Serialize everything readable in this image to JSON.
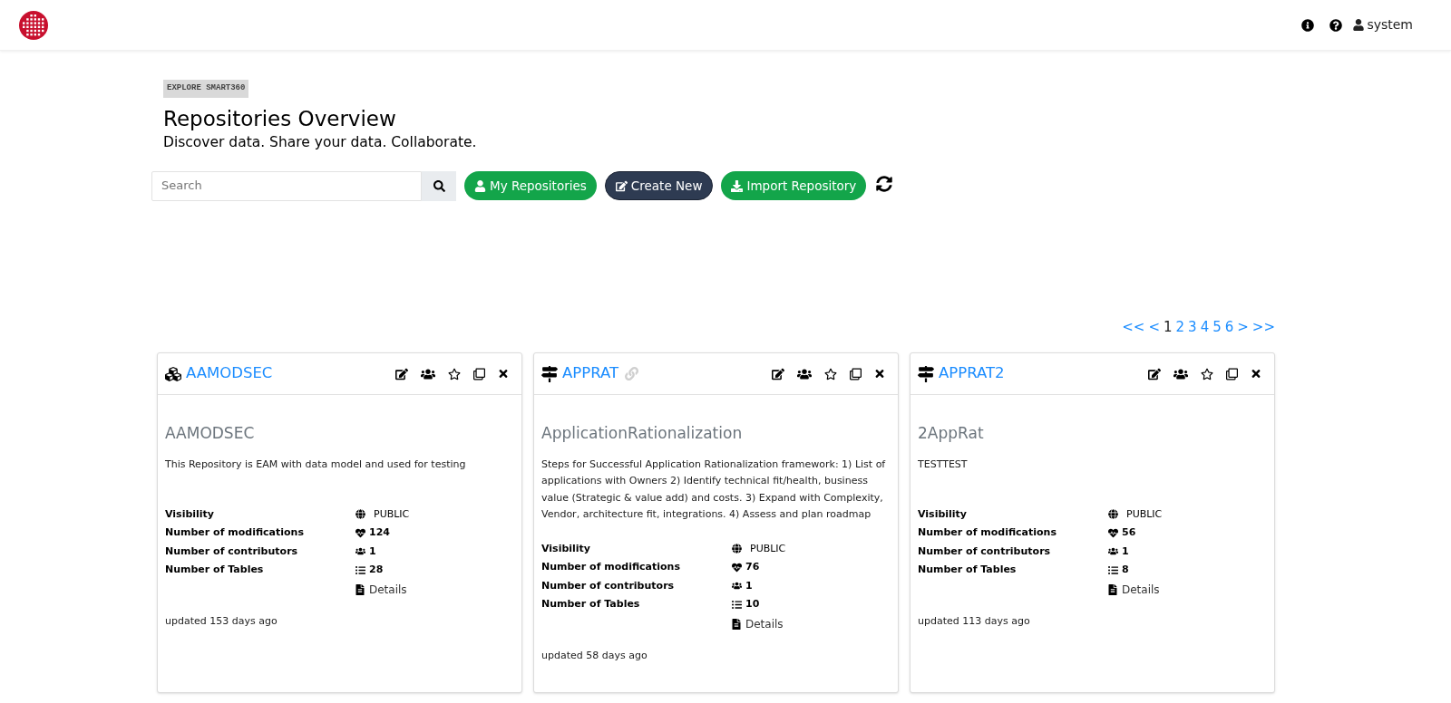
{
  "header": {
    "user": "system"
  },
  "badge": "EXPLORE SMART360",
  "title": "Repositories Overview",
  "subtitle": "Discover data. Share your data. Collaborate.",
  "search": {
    "placeholder": "Search"
  },
  "actions": [
    {
      "label": "My Repositories",
      "kind": "mine"
    },
    {
      "label": "Create New",
      "kind": "create"
    },
    {
      "label": "Import Repository",
      "kind": "import"
    }
  ],
  "pagination": [
    {
      "label": "<<",
      "selected": false
    },
    {
      "label": "<",
      "selected": false
    },
    {
      "label": "1",
      "selected": true
    },
    {
      "label": "2",
      "selected": false
    },
    {
      "label": "3",
      "selected": false
    },
    {
      "label": "4",
      "selected": false
    },
    {
      "label": "5",
      "selected": false
    },
    {
      "label": "6",
      "selected": false
    },
    {
      "label": ">",
      "selected": false
    },
    {
      "label": ">>",
      "selected": false
    }
  ],
  "repositories": [
    {
      "kind": "cubes",
      "name": "AAMODSEC",
      "linked": false,
      "title": "AAMODSEC",
      "description": "This Repository is EAM with data model and used for testing",
      "stats": [
        {
          "label": "Visibility",
          "value": "PUBLIC"
        },
        {
          "label": "Number of modifications",
          "value": "124"
        },
        {
          "label": "Number of contributors",
          "value": "1"
        },
        {
          "label": "Number of Tables",
          "value": "28"
        }
      ],
      "details": "Details",
      "updated": "updated 153 days ago"
    },
    {
      "kind": "signpost",
      "name": "APPRAT",
      "linked": true,
      "title": "ApplicationRationalization",
      "description": "Steps for Successful Application Rationalization framework: 1) List of applications with Owners 2) Identify technical fit/health, business value (Strategic & value add) and costs. 3) Expand with Complexity, Vendor, architecture fit, integrations. 4) Assess and plan roadmap",
      "stats": [
        {
          "label": "Visibility",
          "value": "PUBLIC"
        },
        {
          "label": "Number of modifications",
          "value": "76"
        },
        {
          "label": "Number of contributors",
          "value": "1"
        },
        {
          "label": "Number of Tables",
          "value": "10"
        }
      ],
      "details": "Details",
      "updated": "updated 58 days ago"
    },
    {
      "kind": "signpost",
      "name": "APPRAT2",
      "linked": false,
      "title": "2AppRat",
      "description": "TESTTEST",
      "stats": [
        {
          "label": "Visibility",
          "value": "PUBLIC"
        },
        {
          "label": "Number of modifications",
          "value": "56"
        },
        {
          "label": "Number of contributors",
          "value": "1"
        },
        {
          "label": "Number of Tables",
          "value": "8"
        }
      ],
      "details": "Details",
      "updated": "updated 113 days ago"
    }
  ]
}
